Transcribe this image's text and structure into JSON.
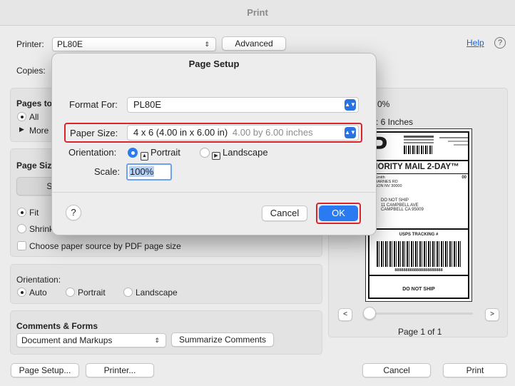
{
  "window": {
    "title": "Print"
  },
  "printer": {
    "label": "Printer:",
    "value": "PL80E",
    "advanced": "Advanced",
    "help": "Help"
  },
  "copies": {
    "label": "Copies:"
  },
  "pages": {
    "heading": "Pages to",
    "all": "All",
    "more": "More"
  },
  "page_size": {
    "heading": "Page Siz",
    "size_btn": "Si",
    "fit": "Fit",
    "shrink": "Shrink",
    "choose_source": "Choose paper source by PDF page size"
  },
  "orientation": {
    "heading": "Orientation:",
    "auto": "Auto",
    "portrait": "Portrait",
    "landscape": "Landscape"
  },
  "comments": {
    "heading": "Comments & Forms",
    "value": "Document and Markups",
    "summarize": "Summarize Comments"
  },
  "bottom": {
    "page_setup": "Page Setup...",
    "printer": "Printer...",
    "cancel": "Cancel",
    "print": "Print"
  },
  "preview": {
    "zoom": "0%",
    "size_text": ": 6 Inches",
    "page_label": "Page 1 of 1",
    "prev": "<",
    "next": ">",
    "lbl_big_p": "P",
    "lbl_service": "RIORITY MAIL 2-DAY™",
    "lbl_sender1": "hn Smith",
    "lbl_sender2": "34 BARNES RD",
    "lbl_sender3": "ARSON NV 30000",
    "lbl_code": "00",
    "lbl_ship": "DO NOT SHIP",
    "lbl_addr1": "11 CAMPBELL AVE",
    "lbl_addr2": "CAMPBELL CA 95009",
    "lbl_tracking": "USPS TRACKING #",
    "lbl_number": "8888888888888888888888",
    "lbl_footer": "DO NOT SHIP"
  },
  "sheet": {
    "title": "Page Setup",
    "format_label": "Format For:",
    "format_value": "PL80E",
    "paper_label": "Paper Size:",
    "paper_value": "4 x 6 (4.00 in x 6.00 in)",
    "paper_hint": "4.00 by 6.00 inches",
    "orientation_label": "Orientation:",
    "portrait": "Portrait",
    "landscape": "Landscape",
    "scale_label": "Scale:",
    "scale_value": "100%",
    "help": "?",
    "cancel": "Cancel",
    "ok": "OK"
  },
  "colors": {
    "accent": "#2a7af1",
    "highlight": "#d8262c",
    "link": "#1a64d8"
  }
}
